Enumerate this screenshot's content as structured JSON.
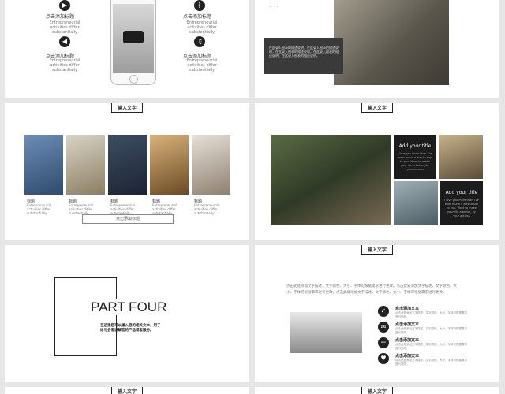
{
  "tab_label": "输入文字",
  "s1": {
    "titles": [
      "点击添加标题",
      "点击添加标题",
      "点击添加标题",
      "点击添加标题"
    ],
    "desc": "Entrepreneurial activities differ substantially"
  },
  "s2": {
    "body": "在此录入图表的描述说明，在此录入图表的描述说明，在此录入图表的描述说明，在此录入图表的描述说明。在此录入图表的描述说明。"
  },
  "s3": {
    "items": [
      {
        "title": "标题",
        "desc": "Entrepreneurial activities differ substantially"
      },
      {
        "title": "标题",
        "desc": "Entrepreneurial activities differ substantially"
      },
      {
        "title": "标题",
        "desc": "Entrepreneurial activities differ substantially"
      },
      {
        "title": "标题",
        "desc": "Entrepreneurial activities differ substantially"
      },
      {
        "title": "标题",
        "desc": "Entrepreneurial activities differ substantially"
      }
    ],
    "button": "点击添加标题"
  },
  "s4": {
    "box1_title": "Add your title",
    "box1_text": "I love you more than I've ever found a way to say to you. Want to make your life a better, by your actions",
    "box2_title": "Add your title",
    "box2_text": "I love you more than I've ever found a way to say to you. Want to make your life a better, by your actions"
  },
  "s5": {
    "title": "PART FOUR",
    "subtitle": "在这里您可以输入您的相关文本，用于给与会者讲解您的产品或者服务。"
  },
  "s6": {
    "intro": "点击此处添加文字描述，文字颜色、大小、字体可根据需求进行更改。点击此处添加文字描述，文字颜色、大小、字体可根据需求进行更改。点击此处添加文字描述，文字颜色、大小、字体可根据需求进行更改。",
    "items": [
      {
        "icon": "✓",
        "title": "点击添加文本",
        "text": "点击此处添加文字描述，文字颜色、大小、字体可根据需求进行更改。"
      },
      {
        "icon": "✉",
        "title": "点击添加文本",
        "text": "点击此处添加文字描述，文字颜色、大小、字体可根据需求进行更改。"
      },
      {
        "icon": "☰",
        "title": "点击添加文本",
        "text": "点击此处添加文字描述，文字颜色、大小、字体可根据需求进行更改。"
      },
      {
        "icon": "♥",
        "title": "点击添加文本",
        "text": "点击此处添加文字描述，文字颜色、大小、字体可根据需求进行更改。"
      }
    ]
  }
}
